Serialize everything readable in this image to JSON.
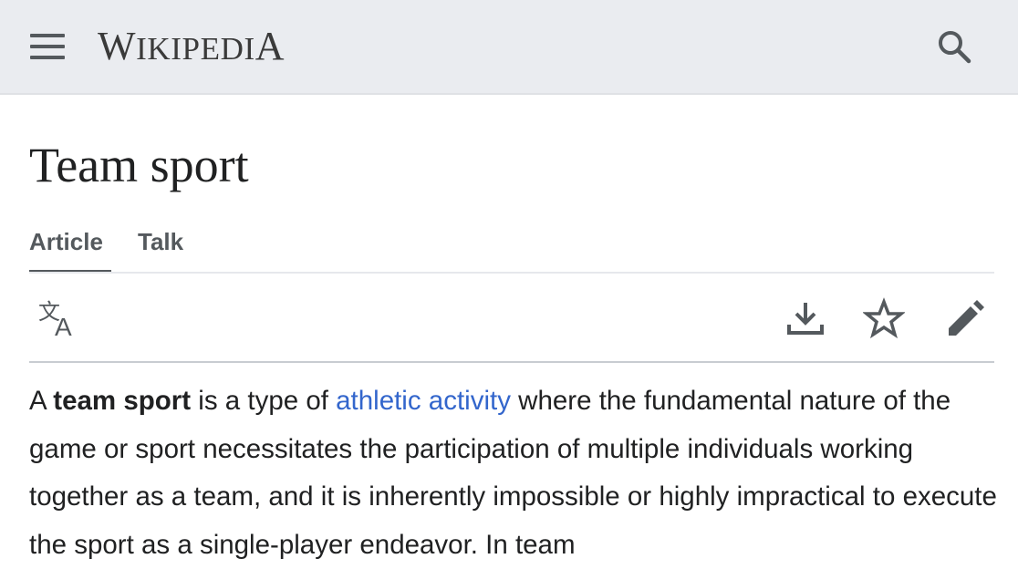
{
  "header": {
    "menu_icon": "hamburger-menu-icon",
    "wordmark": {
      "cap_w": "W",
      "rest_w": "IKIPEDI",
      "cap_a": "A"
    },
    "search_icon": "search-icon"
  },
  "page": {
    "title": "Team sport"
  },
  "tabs": [
    {
      "label": "Article",
      "selected": true
    },
    {
      "label": "Talk",
      "selected": false
    }
  ],
  "toolbar": {
    "language_icon": "language-icon",
    "download_icon": "download-icon",
    "watch_icon": "star-icon",
    "edit_icon": "pencil-edit-icon"
  },
  "content": {
    "p1": "A ",
    "bold": "team sport",
    "p2": " is a type of ",
    "link": "athletic activity",
    "p3": " where the fundamental nature of the game or sport necessitates the participation of multiple individuals working together as a team, and it is inherently impossible or highly impractical to execute the sport as a single-player endeavor. In team"
  },
  "colors": {
    "header_bg": "#eaecf0",
    "text": "#202122",
    "link": "#3366cc",
    "icon": "#54595d"
  }
}
